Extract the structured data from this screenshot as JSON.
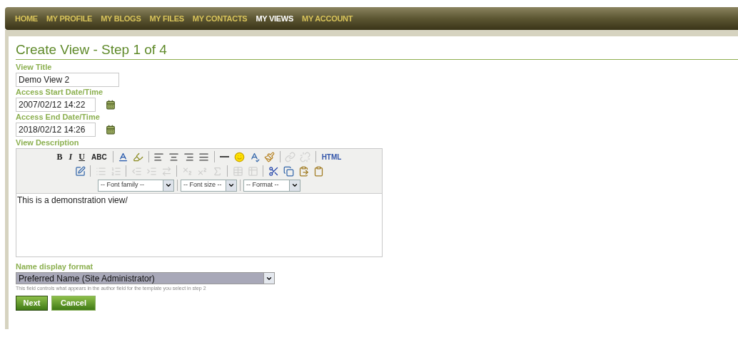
{
  "nav": [
    {
      "label": "HOME",
      "selected": false
    },
    {
      "label": "MY PROFILE",
      "selected": false
    },
    {
      "label": "MY BLOGS",
      "selected": false
    },
    {
      "label": "MY FILES",
      "selected": false
    },
    {
      "label": "MY CONTACTS",
      "selected": false
    },
    {
      "label": "MY VIEWS",
      "selected": true
    },
    {
      "label": "MY ACCOUNT",
      "selected": false
    }
  ],
  "title": "Create View - Step 1 of 4",
  "fields": [
    {
      "label": "View Title",
      "value": "Demo View 2",
      "kind": "text"
    },
    {
      "label": "Access Start Date/Time",
      "value": "2007/02/12 14:22",
      "kind": "date"
    },
    {
      "label": "Access End Date/Time",
      "value": "2018/02/12 14:26",
      "kind": "date"
    }
  ],
  "editor": {
    "label": "View Description",
    "toolbar_rows": [
      [
        {
          "kind": "glyph",
          "label": "B",
          "disabled": false
        },
        {
          "kind": "glyph",
          "label": "I",
          "disabled": false
        },
        {
          "kind": "glyph",
          "label": "U",
          "disabled": false
        },
        {
          "kind": "glyph",
          "label": "ABC",
          "disabled": false
        },
        {
          "kind": "separator"
        },
        {
          "kind": "icon",
          "disabled": false
        },
        {
          "kind": "icon",
          "disabled": false
        },
        {
          "kind": "separator"
        },
        {
          "kind": "icon",
          "disabled": false
        },
        {
          "kind": "icon",
          "disabled": false
        },
        {
          "kind": "icon",
          "disabled": false
        },
        {
          "kind": "icon",
          "disabled": false
        },
        {
          "kind": "separator"
        },
        {
          "kind": "icon",
          "disabled": false
        },
        {
          "kind": "icon",
          "disabled": false
        },
        {
          "kind": "icon",
          "disabled": false
        },
        {
          "kind": "icon",
          "disabled": false
        },
        {
          "kind": "separator"
        },
        {
          "kind": "icon",
          "disabled": true
        },
        {
          "kind": "icon",
          "disabled": true
        },
        {
          "kind": "separator"
        },
        {
          "kind": "glyph",
          "label": "HTML",
          "disabled": false
        }
      ],
      [
        {
          "kind": "icon",
          "disabled": false
        },
        {
          "kind": "separator"
        },
        {
          "kind": "icon",
          "disabled": true
        },
        {
          "kind": "icon",
          "disabled": true
        },
        {
          "kind": "separator"
        },
        {
          "kind": "icon",
          "disabled": true
        },
        {
          "kind": "icon",
          "disabled": true
        },
        {
          "kind": "icon",
          "disabled": true
        },
        {
          "kind": "separator"
        },
        {
          "kind": "icon",
          "disabled": true
        },
        {
          "kind": "icon",
          "disabled": true
        },
        {
          "kind": "icon",
          "disabled": true
        },
        {
          "kind": "separator"
        },
        {
          "kind": "icon",
          "disabled": true
        },
        {
          "kind": "icon",
          "disabled": true
        },
        {
          "kind": "separator"
        },
        {
          "kind": "icon",
          "disabled": false
        },
        {
          "kind": "icon",
          "disabled": false
        },
        {
          "kind": "icon",
          "disabled": false
        },
        {
          "kind": "icon",
          "disabled": false
        }
      ]
    ],
    "dropdowns": [
      "-- Font family --",
      "-- Font size --",
      "-- Format --"
    ],
    "content": "This is a demonstration view/"
  },
  "name_format": {
    "label": "Name display format",
    "value": "Preferred Name (Site Administrator)",
    "hint": "This field controls what appears in the author field for the template you select in step 2"
  },
  "buttons": [
    "Next",
    "Cancel"
  ]
}
